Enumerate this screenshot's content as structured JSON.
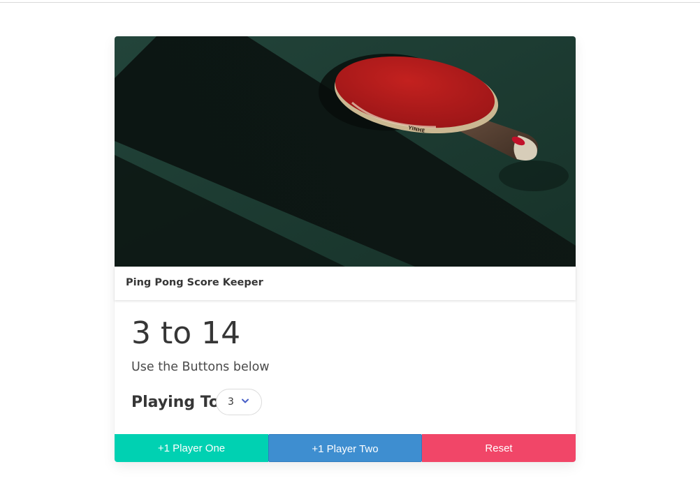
{
  "card": {
    "title": "Ping Pong Score Keeper"
  },
  "image": {
    "paddle_brand": "YINHE"
  },
  "score": {
    "display": "3 to 14",
    "subtitle": "Use the Buttons below"
  },
  "playing_to": {
    "label": "Playing To",
    "selected_value": "3"
  },
  "buttons": {
    "player_one": "+1 Player One",
    "player_two": "+1 Player Two",
    "reset": "Reset"
  },
  "colors": {
    "player_one": "#00d1b2",
    "player_two": "#3e8ed0",
    "reset": "#f14668",
    "table": "#1e3b33",
    "paddle_rubber": "#b81b1d"
  }
}
